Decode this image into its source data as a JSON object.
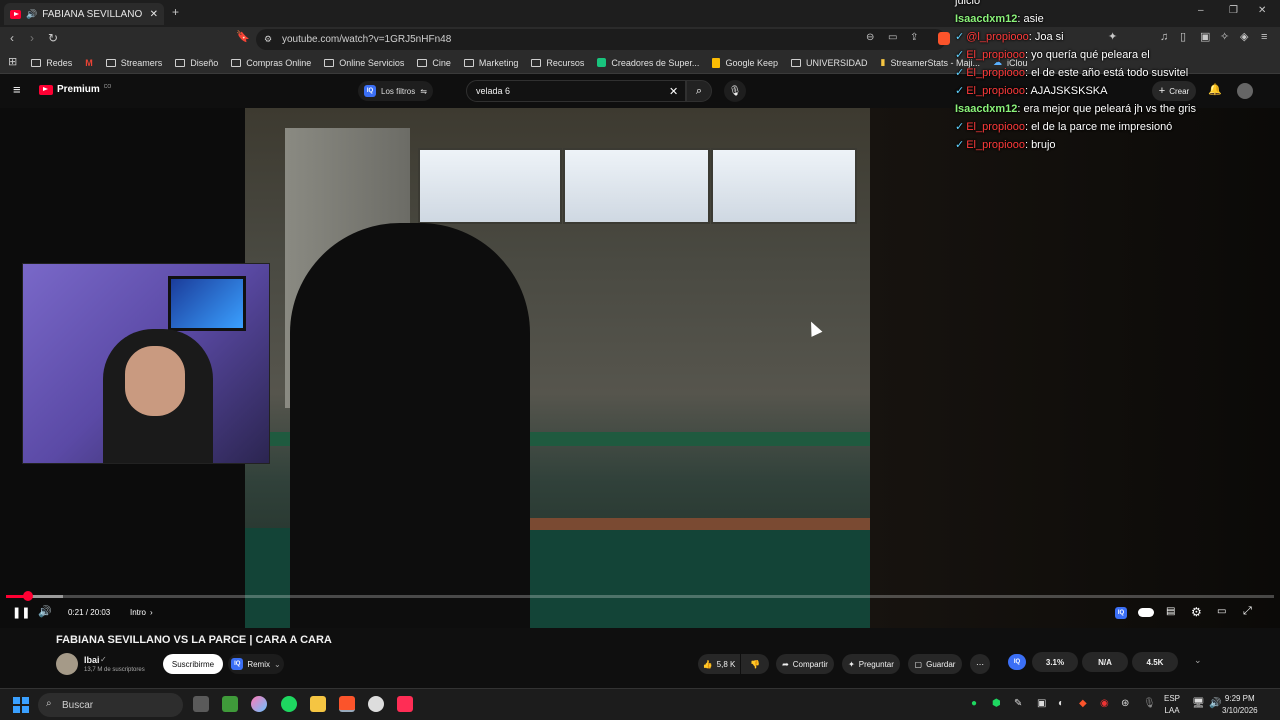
{
  "browser": {
    "tab_title": "FABIANA SEVILLANO VS LA P",
    "url": "youtube.com/watch?v=1GRJ5nHFn48",
    "new_tab_icon": "plus-icon",
    "window_controls": [
      "minimize-icon",
      "maximize-icon",
      "close-icon"
    ]
  },
  "bookmarks": [
    {
      "label": "Redes",
      "icon": "folder-icon"
    },
    {
      "label": "",
      "icon": "gmail-icon"
    },
    {
      "label": "Streamers",
      "icon": "folder-icon"
    },
    {
      "label": "Diseño",
      "icon": "folder-icon"
    },
    {
      "label": "Compras Online",
      "icon": "folder-icon"
    },
    {
      "label": "Online Servicios",
      "icon": "folder-icon"
    },
    {
      "label": "Cine",
      "icon": "folder-icon"
    },
    {
      "label": "Marketing",
      "icon": "folder-icon"
    },
    {
      "label": "Recursos",
      "icon": "folder-icon"
    },
    {
      "label": "Creadores de Super...",
      "icon": "green-icon"
    },
    {
      "label": "Google Keep",
      "icon": "keep-icon"
    },
    {
      "label": "UNIVERSIDAD",
      "icon": "folder-icon"
    },
    {
      "label": "StreamerStats - Maji...",
      "icon": "chart-icon"
    },
    {
      "label": "iClou",
      "icon": "cloud-icon"
    }
  ],
  "youtube": {
    "logo": "Premium",
    "logo_sup": "CO",
    "filters_label": "Los filtros",
    "search_value": "velada 6",
    "create_label": "Crear"
  },
  "player": {
    "time": "0:21 / 20:03",
    "chapter": "Intro",
    "progress_fraction": 0.0175,
    "buffer_fraction": 0.045
  },
  "video_info": {
    "title": "FABIANA SEVILLANO VS LA PARCE | CARA A CARA",
    "channel": "Ibai",
    "subscribers": "13,7 M de suscriptores",
    "subscribe_label": "Suscribirme",
    "remix_label": "Remix",
    "likes": "5,8 K",
    "share_label": "Compartir",
    "ask_label": "Preguntar",
    "save_label": "Guardar",
    "ext_stats": [
      "3.1%",
      "N/A",
      "4.5K"
    ],
    "ext_badge": "IQ"
  },
  "chat": [
    {
      "user": "",
      "text": "juicio",
      "color": "white"
    },
    {
      "user": "Isaacdxm12",
      "text": "asie",
      "color": "green"
    },
    {
      "user": "@l_propiooo",
      "text": "Joa si",
      "color": "red",
      "pinned": true
    },
    {
      "user": "El_propiooo",
      "text": "yo quería qué peleara el",
      "color": "red",
      "pinned": true
    },
    {
      "user": "El_propiooo",
      "text": "el de este año está todo susvitel",
      "color": "red",
      "pinned": true
    },
    {
      "user": "El_propiooo",
      "text": "AJAJSKSKSKA",
      "color": "red",
      "pinned": true
    },
    {
      "user": "Isaacdxm12",
      "text": "era mejor que peleará jh vs the gris",
      "color": "green"
    },
    {
      "user": "El_propiooo",
      "text": "el de la parce me impresionó",
      "color": "red",
      "pinned": true
    },
    {
      "user": "El_propiooo",
      "text": "brujo",
      "color": "red",
      "pinned": true
    }
  ],
  "taskbar": {
    "search_placeholder": "Buscar",
    "lang_line1": "ESP",
    "lang_line2": "LAA",
    "time": "9:29 PM",
    "date": "3/10/2026"
  },
  "colors": {
    "youtube_red": "#ff0033",
    "chat_green": "#8bf27a",
    "chat_red": "#ff3b3b",
    "background": "#0f0f0f"
  }
}
